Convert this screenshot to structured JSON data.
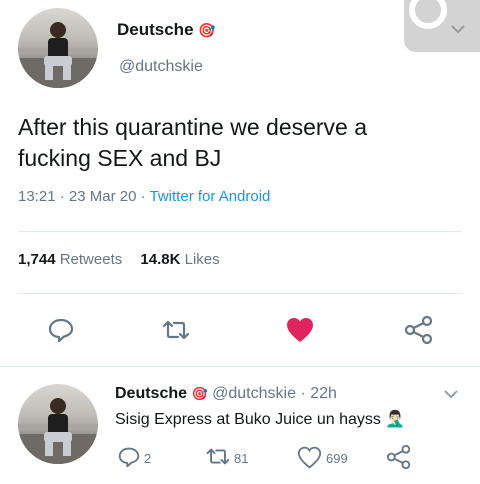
{
  "main_tweet": {
    "display_name": "Deutsche",
    "badge": "🎯",
    "handle": "@dutchskie",
    "text_line1": "After this quarantine we deserve a",
    "text_line2": "fucking SEX and BJ",
    "time": "13:21",
    "date": "23 Mar 20",
    "client": "Twitter for Android",
    "retweets_count": "1,744",
    "retweets_label": "Retweets",
    "likes_count": "14.8K",
    "likes_label": "Likes"
  },
  "reply_tweet": {
    "display_name": "Deutsche",
    "badge": "🎯",
    "handle": "@dutchskie",
    "age": "22h",
    "text": "Sisig Express at Buko Juice un hayss 🤦🏻‍♂️",
    "reply_count": "2",
    "retweet_count": "81",
    "like_count": "699"
  },
  "colors": {
    "like_red": "#e0245e",
    "link_blue": "#1b95e0",
    "muted": "#657786"
  },
  "icons": [
    "target-emoji",
    "reply-icon",
    "retweet-icon",
    "heart-icon",
    "share-icon",
    "chevron-down-icon"
  ]
}
